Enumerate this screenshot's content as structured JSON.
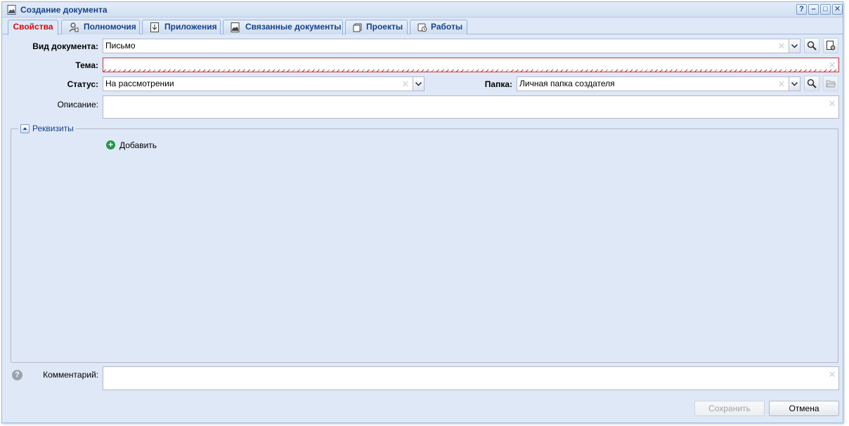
{
  "window": {
    "title": "Создание документа",
    "icon": "document-icon",
    "tools": {
      "help": "?",
      "minimize": "–",
      "maximize": "□",
      "close": "✕"
    }
  },
  "tabs": [
    {
      "label": "Свойства",
      "icon": null,
      "active": true
    },
    {
      "label": "Полномочия",
      "icon": "user-permissions-icon",
      "active": false
    },
    {
      "label": "Приложения",
      "icon": "attachment-icon",
      "active": false
    },
    {
      "label": "Связанные документы",
      "icon": "linked-documents-icon",
      "active": false
    },
    {
      "label": "Проекты",
      "icon": "projects-icon",
      "active": false
    },
    {
      "label": "Работы",
      "icon": "works-icon",
      "active": false
    }
  ],
  "form": {
    "doc_type": {
      "label": "Вид документа:",
      "value": "Письмо"
    },
    "subject": {
      "label": "Тема:",
      "value": ""
    },
    "status": {
      "label": "Статус:",
      "value": "На рассмотрении"
    },
    "folder": {
      "label": "Папка:",
      "value": "Личная папка создателя"
    },
    "description": {
      "label": "Описание:",
      "value": ""
    },
    "requisites": {
      "legend": "Реквизиты",
      "add_label": "Добавить"
    },
    "comment": {
      "label": "Комментарий:",
      "value": ""
    }
  },
  "buttons": {
    "save": "Сохранить",
    "cancel": "Отмена"
  },
  "colors": {
    "active_tab": "#d10a0a",
    "title": "#15428b",
    "add_icon": "#1f9a4a",
    "invalid_border": "#cc3333"
  }
}
